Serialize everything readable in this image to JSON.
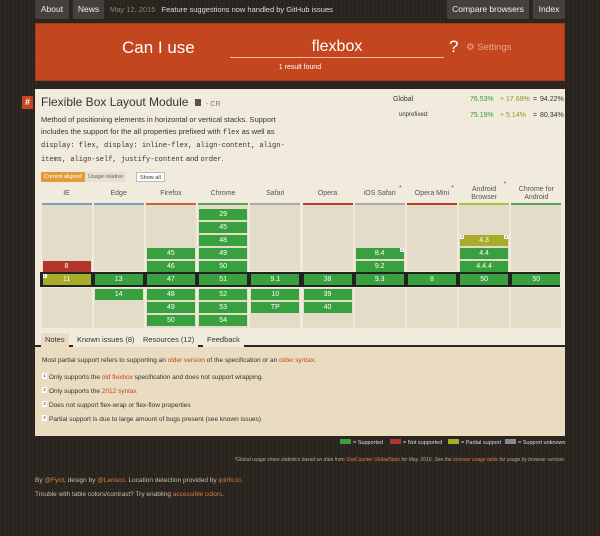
{
  "colors": {
    "supported": "#39a040",
    "not_supported": "#b1362c",
    "partial": "#a8ac2a",
    "unknown": "#888888",
    "brand": "#c3461f"
  },
  "nav": {
    "about": "About",
    "news": "News",
    "news_date": "May 12, 2015",
    "news_text": "Feature suggestions now handled by GitHub issues",
    "compare": "Compare browsers",
    "index": "Index"
  },
  "hero": {
    "prefix": "Can I use",
    "query": "flexbox",
    "qmark": "?",
    "settings": "Settings",
    "settings_icon": "gear-icon",
    "result": "1 result found"
  },
  "feature": {
    "hash": "#",
    "title": "Flexible Box Layout Module",
    "status": "- CR",
    "desc_1": "Method of positioning elements in horizontal or vertical stacks. Support includes the support for the all properties prefixed with",
    "desc_code_1": "flex",
    "desc_2": " as well as ",
    "desc_code_2": "display: flex, display: inline-flex, align-content, align-items, align-self, justify-content",
    "desc_3": " and ",
    "desc_code_3": "order",
    "desc_4": ".",
    "stats": {
      "global_label": "Global",
      "global_supported": "76.53%",
      "global_partial": "+ 17.69%",
      "global_eq": "=",
      "global_total": "94.22%",
      "unprefixed_label": "unprefixed:",
      "unprefixed_supported": "75.19%",
      "unprefixed_partial": "+ 5.14%",
      "unprefixed_eq": "=",
      "unprefixed_total": "80.34%"
    },
    "toggles": {
      "current_aligned": "Current aligned",
      "usage_relative": "Usage relative",
      "show_all": "Show all"
    }
  },
  "browsers": [
    {
      "name": "IE",
      "star": "",
      "line": "#7b9ec1"
    },
    {
      "name": "Edge",
      "star": "",
      "line": "#7b9ec1"
    },
    {
      "name": "Firefox",
      "star": "",
      "line": "#d1632f"
    },
    {
      "name": "Chrome",
      "star": "",
      "line": "#59a452"
    },
    {
      "name": "Safari",
      "star": "",
      "line": "#aaaaaa"
    },
    {
      "name": "Opera",
      "star": "",
      "line": "#c0392b"
    },
    {
      "name": "iOS Safari",
      "star": "*",
      "line": "#aaaaaa"
    },
    {
      "name": "Opera Mini",
      "star": "*",
      "line": "#c0392b"
    },
    {
      "name": "Android Browser",
      "star": "*",
      "line": "#a4c639"
    },
    {
      "name": "Chrome for Android",
      "star": "",
      "line": "#59a452"
    }
  ],
  "support_table": {
    "IE": {
      "past": [
        {
          "v": "8",
          "s": "n"
        }
      ],
      "current": {
        "v": "11",
        "s": "p",
        "note": "1"
      },
      "future": []
    },
    "Edge": {
      "past": [],
      "current": {
        "v": "13",
        "s": "y"
      },
      "future": [
        {
          "v": "14",
          "s": "y"
        }
      ]
    },
    "Firefox": {
      "past": [
        {
          "v": "45",
          "s": "y"
        },
        {
          "v": "46",
          "s": "y"
        }
      ],
      "current": {
        "v": "47",
        "s": "y"
      },
      "future": [
        {
          "v": "48",
          "s": "y"
        },
        {
          "v": "49",
          "s": "y"
        },
        {
          "v": "50",
          "s": "y"
        }
      ]
    },
    "Chrome": {
      "past": [
        {
          "v": "29",
          "s": "y"
        },
        {
          "v": "45",
          "s": "y"
        },
        {
          "v": "48",
          "s": "y"
        },
        {
          "v": "49",
          "s": "y"
        },
        {
          "v": "50",
          "s": "y"
        }
      ],
      "current": {
        "v": "51",
        "s": "y"
      },
      "future": [
        {
          "v": "52",
          "s": "y"
        },
        {
          "v": "53",
          "s": "y"
        },
        {
          "v": "54",
          "s": "y"
        }
      ]
    },
    "Safari": {
      "past": [],
      "current": {
        "v": "9.1",
        "s": "y"
      },
      "future": [
        {
          "v": "10",
          "s": "y"
        },
        {
          "v": "TP",
          "s": "y"
        }
      ]
    },
    "Opera": {
      "past": [],
      "current": {
        "v": "38",
        "s": "y"
      },
      "future": [
        {
          "v": "39",
          "s": "y"
        },
        {
          "v": "40",
          "s": "y"
        }
      ]
    },
    "iOS Safari": {
      "past": [
        {
          "v": "8.4",
          "s": "y",
          "note": "4"
        },
        {
          "v": "9.2",
          "s": "y"
        }
      ],
      "current": {
        "v": "9.3",
        "s": "y"
      },
      "future": []
    },
    "Opera Mini": {
      "past": [],
      "current": {
        "v": "8",
        "s": "y"
      },
      "future": []
    },
    "Android Browser": {
      "past": [
        {
          "v": "4.3",
          "s": "p",
          "note": "1",
          "note2": "4"
        },
        {
          "v": "4.4",
          "s": "y"
        },
        {
          "v": "4.4.4",
          "s": "y"
        }
      ],
      "current": {
        "v": "50",
        "s": "y"
      },
      "future": []
    },
    "Chrome for Android": {
      "past": [],
      "current": {
        "v": "50",
        "s": "y"
      },
      "future": []
    }
  },
  "tabs": [
    "Notes",
    "Known issues (8)",
    "Resources (12)",
    "Feedback"
  ],
  "notes": {
    "intro_pre": "Most partial support refers to supporting an ",
    "intro_link_1": "older version",
    "intro_mid": " of the specification or an ",
    "intro_link_2": "older syntax",
    "intro_post": ".",
    "items": [
      {
        "num": "1",
        "pre": "Only supports the ",
        "link": "old flexbox",
        "post": " specification and does not support wrapping."
      },
      {
        "num": "2",
        "pre": "Only supports the ",
        "link": "2012 syntax",
        "post": ""
      },
      {
        "num": "3",
        "pre": "Does not support flex-wrap or flex-flow properties",
        "link": "",
        "post": ""
      },
      {
        "num": "4",
        "pre": "Partial support is due to large amount of bugs present (see known issues)",
        "link": "",
        "post": ""
      }
    ]
  },
  "legend": {
    "supported": "= Supported",
    "not_supported": "= Not supported",
    "partial": "= Partial support",
    "unknown": "= Support unknown"
  },
  "footnote": {
    "pre": "*Global usage share statistics based on data from ",
    "link_1": "StatCounter GlobalStats",
    "mid": " for May, 2016. See the ",
    "link_2": "browser usage table",
    "post": " for usage by browser version."
  },
  "credits": {
    "by": "By ",
    "fyrd": "@Fyrd",
    "design": ", design by ",
    "lensco": "@Lensco",
    "location": ". Location detection provided by ",
    "ipinfo": "ipinfo.io",
    "end": "."
  },
  "contrast": {
    "pre": "Trouble with table colors/contrast? Try enabling ",
    "link": "accessible colors",
    "post": "."
  }
}
